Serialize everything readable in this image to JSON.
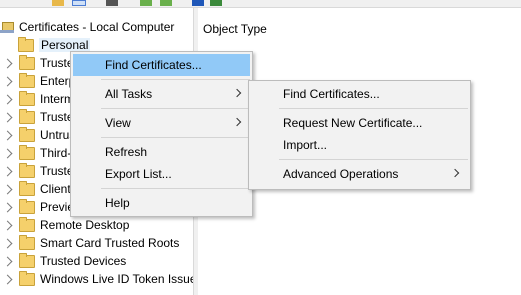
{
  "tree": {
    "root_label": "Certificates - Local Computer",
    "items": [
      {
        "label": "Personal",
        "has_expander": false
      },
      {
        "label": "Truste",
        "has_expander": true
      },
      {
        "label": "Enterp",
        "has_expander": true
      },
      {
        "label": "Interm",
        "has_expander": true
      },
      {
        "label": "Truste",
        "has_expander": true
      },
      {
        "label": "Untrus",
        "has_expander": true
      },
      {
        "label": "Third-",
        "has_expander": true
      },
      {
        "label": "Truste",
        "has_expander": true
      },
      {
        "label": "Client",
        "has_expander": true
      },
      {
        "label": "Previe",
        "has_expander": true
      },
      {
        "label": "Remote Desktop",
        "has_expander": true
      },
      {
        "label": "Smart Card Trusted Roots",
        "has_expander": true
      },
      {
        "label": "Trusted Devices",
        "has_expander": true
      },
      {
        "label": "Windows Live ID Token Issuer",
        "has_expander": true
      }
    ]
  },
  "content": {
    "column_header": "Object Type"
  },
  "context_menu": {
    "find_certificates": "Find Certificates...",
    "all_tasks": "All Tasks",
    "view": "View",
    "refresh": "Refresh",
    "export_list": "Export List...",
    "help": "Help"
  },
  "submenu": {
    "find_certificates": "Find Certificates...",
    "request_new_certificate": "Request New Certificate...",
    "import": "Import...",
    "advanced_operations": "Advanced Operations"
  },
  "colors": {
    "highlight": "#91c9f7",
    "menu_background": "#f2f2f2",
    "folder": "#f5d06b"
  }
}
